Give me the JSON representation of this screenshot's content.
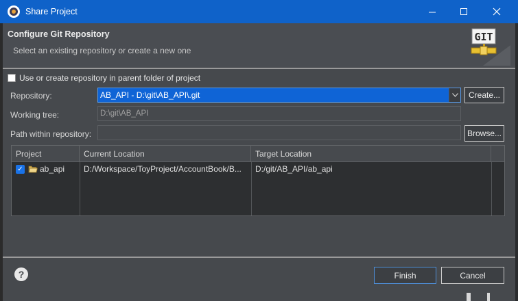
{
  "window": {
    "title": "Share Project",
    "min_glyph": "—",
    "max_glyph": "☐",
    "close_glyph": "✕"
  },
  "header": {
    "title": "Configure Git Repository",
    "subtitle": "Select an existing repository or create a new one",
    "logo_text": "GIT"
  },
  "options": {
    "use_parent_label": "Use or create repository in parent folder of project",
    "use_parent_checked": false
  },
  "form": {
    "repository_label": "Repository:",
    "repository_value": "AB_API - D:\\git\\AB_API\\.git",
    "create_button": "Create...",
    "working_tree_label": "Working tree:",
    "working_tree_value": "D:\\git\\AB_API",
    "path_label": "Path within repository:",
    "path_value": "",
    "browse_button": "Browse..."
  },
  "table": {
    "columns": [
      "Project",
      "Current Location",
      "Target Location"
    ],
    "rows": [
      {
        "checked": true,
        "project": "ab_api",
        "current_location": "D:/Workspace/ToyProject/AccountBook/B...",
        "target_location": "D:/git/AB_API/ab_api"
      }
    ]
  },
  "footer": {
    "help_glyph": "?",
    "finish_button": "Finish",
    "cancel_button": "Cancel"
  },
  "colors": {
    "titlebar": "#0f62c9",
    "selection": "#0f64d6",
    "panel": "#46494d",
    "table_bg": "#2d2f31"
  }
}
